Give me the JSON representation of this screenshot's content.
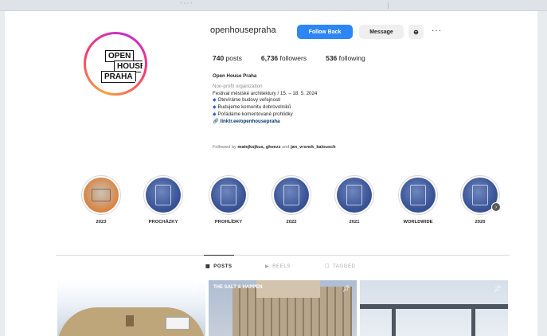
{
  "browser": {
    "tab_fragment": "- ··· -"
  },
  "profile": {
    "username": "openhousepraha",
    "avatar_lines": [
      "OPEN",
      "HOUSE",
      "PRAHA"
    ],
    "buttons": {
      "follow": "Follow Back",
      "message": "Message",
      "suggest": "⊕"
    },
    "more": "···",
    "stats": {
      "posts_count": "740",
      "posts_label": "posts",
      "followers_count": "6,736",
      "followers_label": "followers",
      "following_count": "536",
      "following_label": "following"
    },
    "bio": {
      "name": "Open House Praha",
      "category": "Non-profit organization",
      "lines": [
        "Festival městské architektury / 15. – 18. 5. 2024",
        "Otevíráme budovy veřejnosti",
        "Budujeme komunitu dobrovolníků",
        "Pořádáme komentované prohlídky"
      ],
      "link": "linktr.ee/openhousepraha"
    },
    "followed_by": {
      "prefix": "Followed by",
      "names": "matejkojkus, gheezz",
      "suffix": "and",
      "last": "jan_vrsnek_kalousch"
    }
  },
  "highlights": [
    {
      "label": "2023"
    },
    {
      "label": "PROCHÁZKY"
    },
    {
      "label": "PROHLÍDKY"
    },
    {
      "label": "2022"
    },
    {
      "label": "2021"
    },
    {
      "label": "WORLDWIDE"
    },
    {
      "label": "2020"
    }
  ],
  "tabs": [
    {
      "label": "POSTS",
      "icon": "▦"
    },
    {
      "label": "REELS",
      "icon": "▶"
    },
    {
      "label": "TAGGED",
      "icon": "☐"
    }
  ],
  "posts": [
    {
      "overlay": ""
    },
    {
      "overlay": "THE SALT & HAPPEN"
    },
    {
      "overlay": ""
    }
  ],
  "colors": {
    "primary_button": "#2c86f5",
    "secondary_button": "#efefef",
    "link": "#00376b"
  }
}
